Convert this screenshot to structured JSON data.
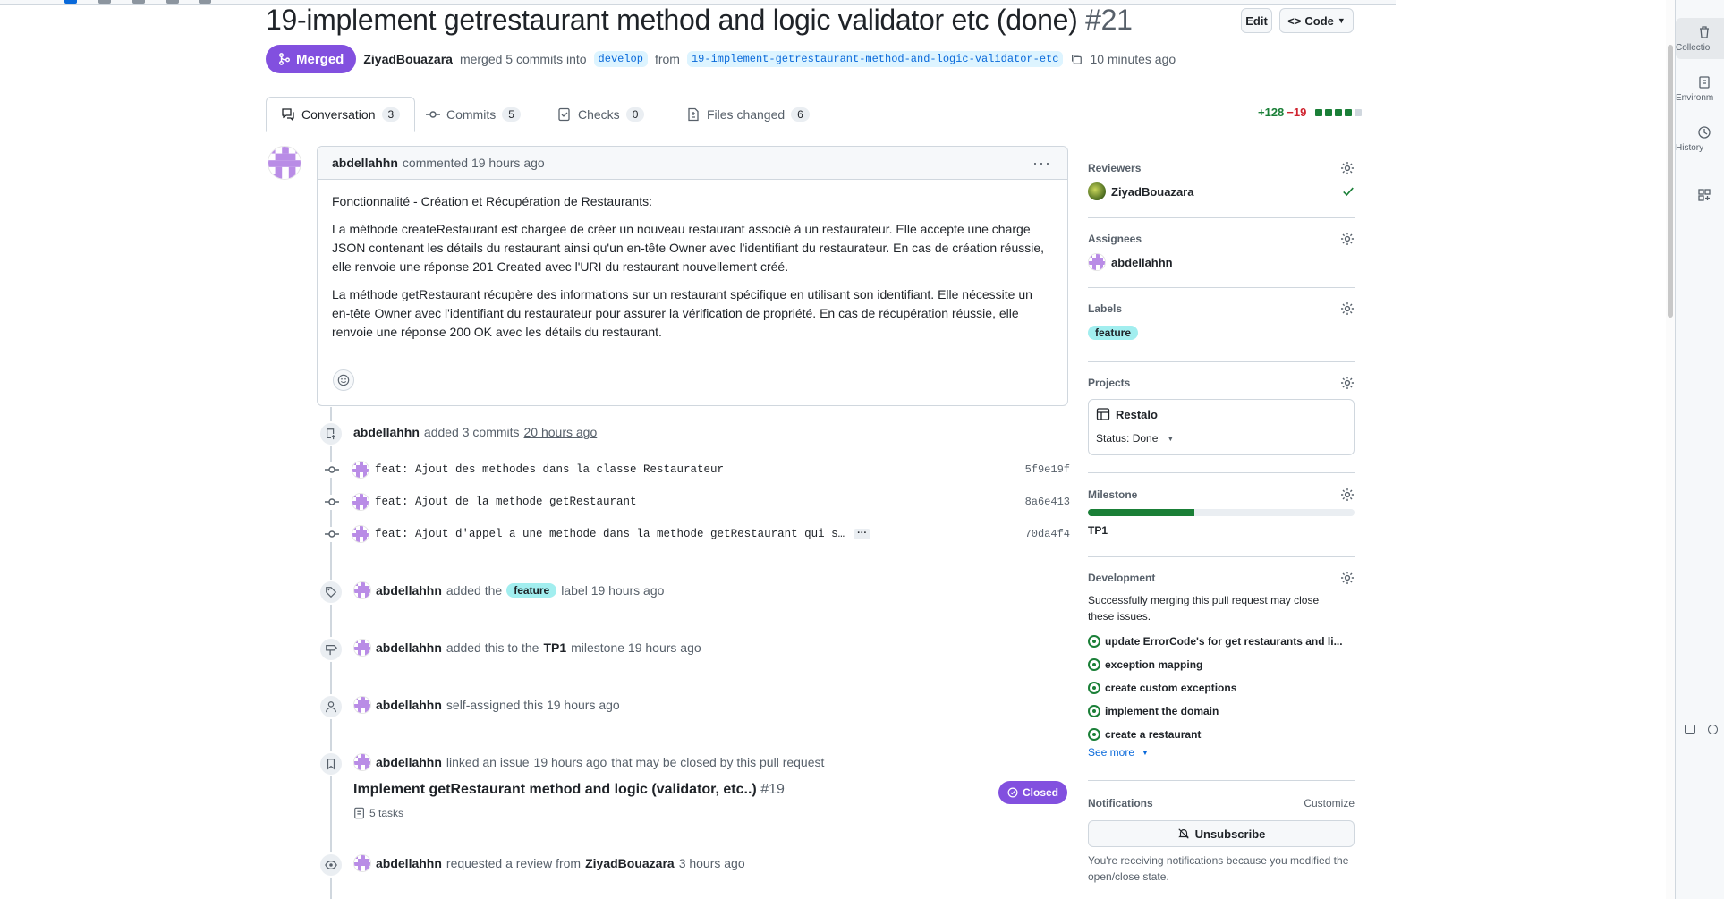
{
  "pr": {
    "title": "19-implement getrestaurant method and logic validator etc (done)",
    "number": "#21",
    "state": "Merged",
    "author": "ZiyadBouazara",
    "merged_text": "merged 5 commits into",
    "base_branch": "develop",
    "from_text": "from",
    "head_branch": "19-implement-getrestaurant-method-and-logic-validator-etc",
    "time": "10 minutes ago",
    "edit_label": "Edit",
    "code_label": "Code"
  },
  "tabs": [
    {
      "label": "Conversation",
      "count": "3"
    },
    {
      "label": "Commits",
      "count": "5"
    },
    {
      "label": "Checks",
      "count": "0"
    },
    {
      "label": "Files changed",
      "count": "6"
    }
  ],
  "diffstat": {
    "additions": "+128",
    "deletions": "−19"
  },
  "comment": {
    "author": "abdellahhn",
    "meta": "commented 19 hours ago",
    "paragraphs": [
      "Fonctionnalité - Création et Récupération de Restaurants:",
      "La méthode createRestaurant est chargée de créer un nouveau restaurant associé à un restaurateur. Elle accepte une charge JSON contenant les détails du restaurant ainsi qu'un en-tête Owner avec l'identifiant du restaurateur. En cas de création réussie, elle renvoie une réponse 201 Created avec l'URI du restaurant nouvellement créé.",
      "La méthode getRestaurant récupère des informations sur un restaurant spécifique en utilisant son identifiant. Elle nécessite un en-tête Owner avec l'identifiant du restaurateur pour assurer la vérification de propriété. En cas de récupération réussie, elle renvoie une réponse 200 OK avec les détails du restaurant."
    ]
  },
  "events": {
    "commits_added": {
      "user": "abdellahhn",
      "text": "added 3 commits",
      "time": "20 hours ago"
    },
    "commits": [
      {
        "message": "feat: Ajout des methodes dans la classe Restaurateur",
        "sha": "5f9e19f"
      },
      {
        "message": "feat: Ajout de la methode getRestaurant",
        "sha": "8a6e413"
      },
      {
        "message": "feat: Ajout d'appel a une methode dans la methode getRestaurant qui s…",
        "sha": "70da4f4"
      }
    ],
    "label": {
      "user": "abdellahhn",
      "pre": "added the",
      "label": "feature",
      "post": "label 19 hours ago"
    },
    "milestone": {
      "user": "abdellahhn",
      "pre": "added this to the",
      "milestone": "TP1",
      "post": "milestone 19 hours ago"
    },
    "assign": {
      "user": "abdellahhn",
      "text": "self-assigned this 19 hours ago"
    },
    "linked": {
      "user": "abdellahhn",
      "pre": "linked an issue",
      "time": "19 hours ago",
      "post": "that may be closed by this pull request"
    },
    "issue": {
      "title": "Implement getRestaurant method and logic (validator, etc..)",
      "number": "#19",
      "state": "Closed",
      "tasks": "5 tasks"
    },
    "review": {
      "user": "abdellahhn",
      "pre": "requested a review from",
      "reviewer": "ZiyadBouazara",
      "post": "3 hours ago"
    }
  },
  "sidebar": {
    "reviewers": {
      "heading": "Reviewers",
      "name": "ZiyadBouazara"
    },
    "assignees": {
      "heading": "Assignees",
      "name": "abdellahhn"
    },
    "labels": {
      "heading": "Labels",
      "label": "feature"
    },
    "projects": {
      "heading": "Projects",
      "name": "Restalo",
      "status": "Status: Done"
    },
    "milestone": {
      "heading": "Milestone",
      "name": "TP1",
      "progress": 0.4
    },
    "development": {
      "heading": "Development",
      "desc": "Successfully merging this pull request may close these issues.",
      "issues": [
        "update ErrorCode's for get restaurants and li...",
        "exception mapping",
        "create custom exceptions",
        "implement the domain",
        "create a restaurant"
      ],
      "see_more": "See more"
    },
    "notifications": {
      "heading": "Notifications",
      "customize": "Customize",
      "unsubscribe": "Unsubscribe",
      "note": "You're receiving notifications because you modified the open/close state."
    }
  },
  "right_panel": [
    "Collectio",
    "Environm",
    "History"
  ],
  "colors": {
    "merged": "#8250df",
    "label": "#a2eeef",
    "add": "#1a7f37",
    "del": "#cf222e"
  }
}
